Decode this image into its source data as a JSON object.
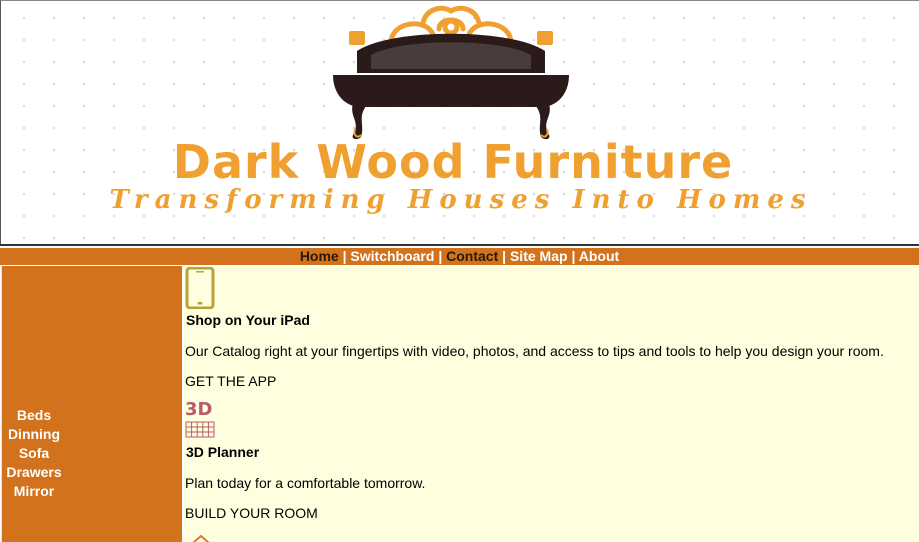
{
  "header": {
    "brand_name": "Dark Wood Furniture",
    "tagline": "Transforming Houses Into Homes",
    "logo_icon": "bed-logo-icon"
  },
  "nav": {
    "items": [
      {
        "label": "Home",
        "style": "dark"
      },
      {
        "label": "Switchboard",
        "style": "light"
      },
      {
        "label": "Contact",
        "style": "dark"
      },
      {
        "label": "Site Map",
        "style": "light"
      },
      {
        "label": "About",
        "style": "light"
      }
    ],
    "separator": "|"
  },
  "sidebar": {
    "items": [
      "Beds",
      "Dinning",
      "Sofa",
      "Drawers",
      "Mirror"
    ]
  },
  "main": {
    "sections": [
      {
        "icon": "tablet-icon",
        "heading": "Shop on Your iPad",
        "text": "Our Catalog right at your fingertips with video, photos, and access to tips and tools to help you design your room.",
        "cta": "GET THE APP"
      },
      {
        "icon": "3d-planner-icon",
        "icon_text": "3D",
        "heading": "3D Planner",
        "text": "Plan today for a comfortable tomorrow.",
        "cta": "BUILD YOUR ROOM"
      }
    ]
  },
  "colors": {
    "accent": "#d2721d",
    "brand_text": "#f0a030",
    "content_bg": "#ffffe0",
    "tablet_icon": "#b5a23a",
    "planner_icon": "#b85a6e"
  }
}
